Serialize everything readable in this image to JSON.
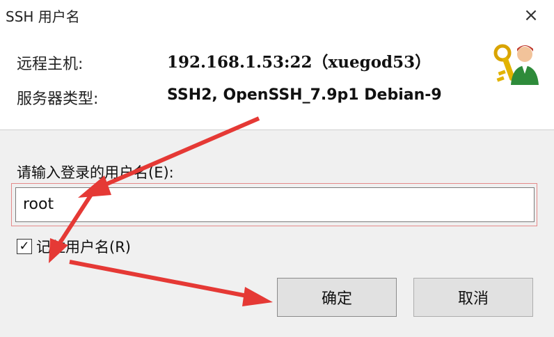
{
  "window": {
    "title": "SSH 用户名",
    "close_glyph": "×"
  },
  "info": {
    "host_label": "远程主机:",
    "host_value": "192.168.1.53:22（xuegod53）",
    "server_type_label": "服务器类型:",
    "server_type_value": "SSH2, OpenSSH_7.9p1 Debian-9"
  },
  "form": {
    "prompt": "请输入登录的用户名(E):",
    "username_value": "root",
    "remember_label": "记住用户名(R)",
    "remember_checked": true,
    "check_glyph": "✓"
  },
  "buttons": {
    "ok_label": "确定",
    "cancel_label": "取消"
  },
  "icons": {
    "header_icon": "keys-user-icon",
    "annotation": "red-arrow-icon"
  },
  "colors": {
    "arrow": "#e53935",
    "input_highlight": "#e58a8a"
  }
}
